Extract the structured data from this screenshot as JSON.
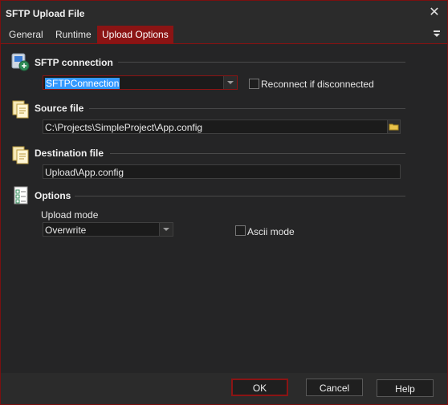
{
  "window": {
    "title": "SFTP Upload File",
    "close_glyph": "✕"
  },
  "tabs": [
    {
      "label": "General"
    },
    {
      "label": "Runtime"
    },
    {
      "label": "Upload Options",
      "active": true
    }
  ],
  "sections": {
    "sftp_connection": {
      "title": "SFTP connection",
      "icon": "sftp-connection-icon",
      "connection_value": "SFTPConnection",
      "reconnect_label": "Reconnect if disconnected",
      "reconnect_checked": false
    },
    "source_file": {
      "title": "Source file",
      "icon": "file-copy-icon",
      "value": "C:\\Projects\\SimpleProject\\App.config"
    },
    "destination_file": {
      "title": "Destination file",
      "icon": "file-copy-icon",
      "value": "Upload\\App.config"
    },
    "options": {
      "title": "Options",
      "icon": "options-checklist-icon",
      "upload_mode_label": "Upload mode",
      "upload_mode_value": "Overwrite",
      "ascii_label": "Ascii mode",
      "ascii_checked": false
    }
  },
  "buttons": {
    "ok": "OK",
    "cancel": "Cancel",
    "help": "Help"
  },
  "colors": {
    "accent": "#8b1414",
    "selection": "#3399ff",
    "background": "#252526"
  }
}
